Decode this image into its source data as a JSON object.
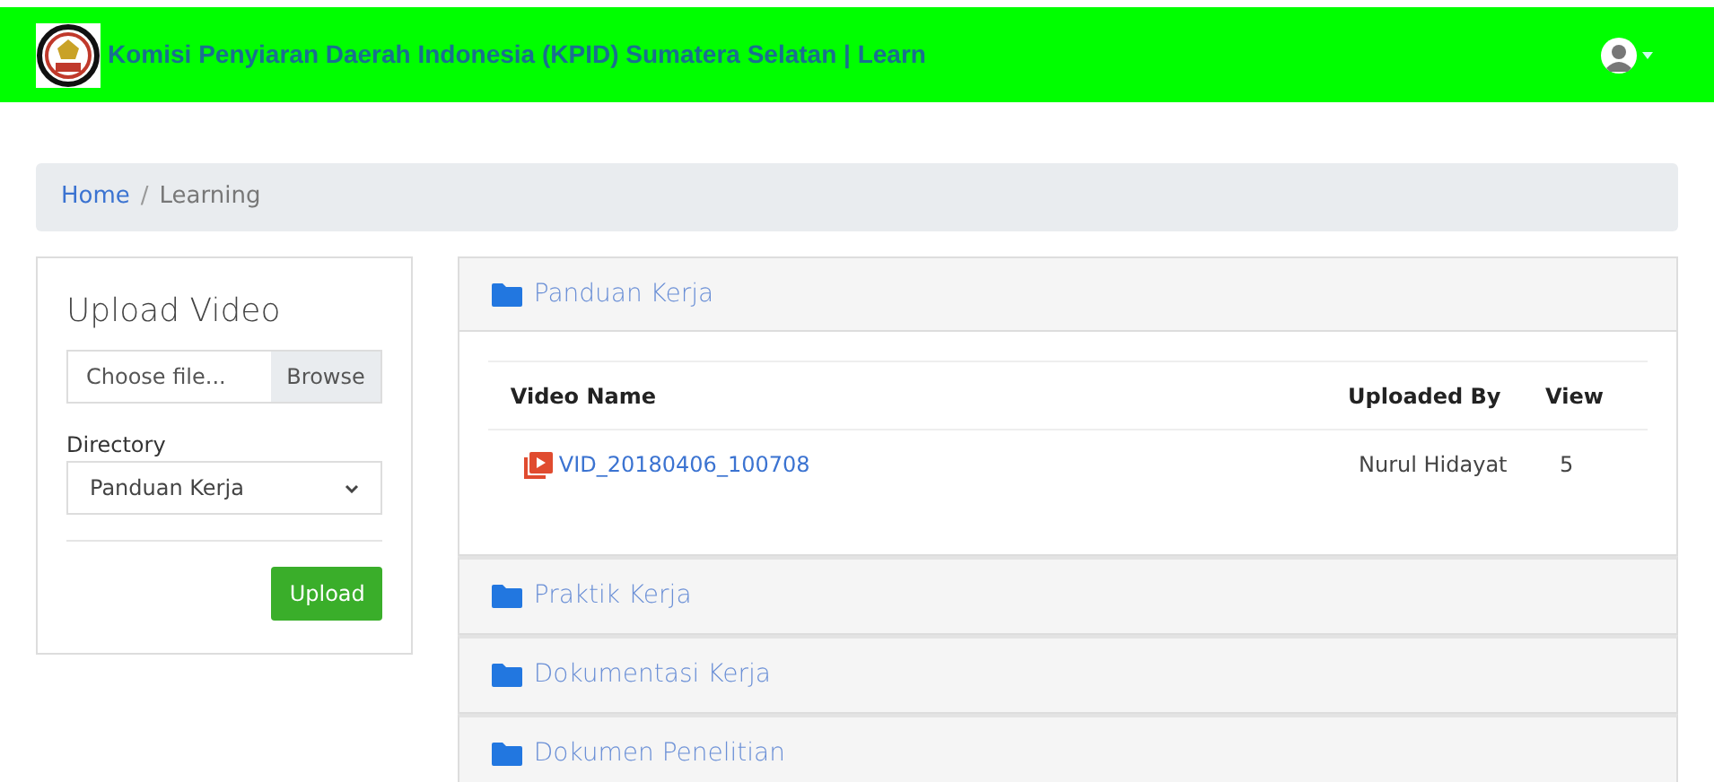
{
  "navbar": {
    "title": "Komisi Penyiaran Daerah Indonesia (KPID) Sumatera Selatan | Learn"
  },
  "breadcrumb": [
    {
      "label": "Home",
      "kind": "link"
    },
    {
      "label": "/",
      "kind": "separator"
    },
    {
      "label": "Learning",
      "kind": "current"
    }
  ],
  "upload_card": {
    "title": "Upload Video",
    "file_placeholder": "Choose file...",
    "browse_label": "Browse",
    "directory_label": "Directory",
    "directory_value": "Panduan Kerja",
    "upload_label": "Upload"
  },
  "folders": [
    {
      "name": "Panduan Kerja",
      "expanded": true,
      "columns": [
        "Video Name",
        "Uploaded By",
        "View"
      ],
      "rows": [
        {
          "name": "VID_20180406_100708",
          "uploaded_by": "Nurul Hidayat",
          "views": "5"
        }
      ]
    },
    {
      "name": "Praktik Kerja",
      "expanded": false
    },
    {
      "name": "Dokumentasi Kerja",
      "expanded": false
    },
    {
      "name": "Dokumen Penelitian",
      "expanded": false
    }
  ]
}
